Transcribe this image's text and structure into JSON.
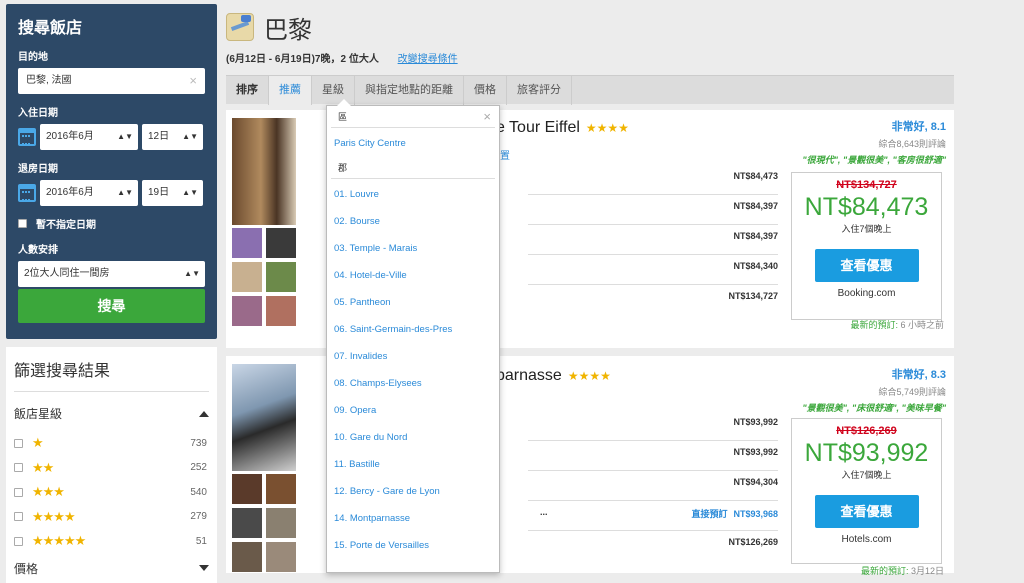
{
  "search": {
    "title": "搜尋飯店",
    "dest_label": "目的地",
    "dest_value": "巴黎, 法國",
    "clear_icon": "×",
    "checkin_label": "入住日期",
    "checkin_month": "2016年6月",
    "checkin_day": "12日",
    "checkout_label": "退房日期",
    "checkout_month": "2016年6月",
    "checkout_day": "19日",
    "nodate_label": "暫不指定日期",
    "guests_label": "人數安排",
    "guests_value": "2位大人同住一間房",
    "button": "搜尋"
  },
  "filter": {
    "title": "篩選搜尋結果",
    "star_header": "飯店星級",
    "stars": [
      {
        "stars": "★",
        "count": "739"
      },
      {
        "stars": "★★",
        "count": "252"
      },
      {
        "stars": "★★★",
        "count": "540"
      },
      {
        "stars": "★★★★",
        "count": "279"
      },
      {
        "stars": "★★★★★",
        "count": "51"
      }
    ],
    "price_header": "價格"
  },
  "header": {
    "city": "巴黎",
    "dates": "(6月12日 - 6月19日)7晚，2 位大人",
    "modify_link": "改變搜尋條件"
  },
  "sort": {
    "label": "排序",
    "tabs": [
      "推薦",
      "星級",
      "與指定地點的距離",
      "價格",
      "旅客評分"
    ]
  },
  "dropdown": {
    "area_header": "區",
    "area_item": "Paris City Centre",
    "district_header": "郡",
    "districts": [
      "01. Louvre",
      "02. Bourse",
      "03. Temple - Marais",
      "04. Hotel-de-Ville",
      "05. Pantheon",
      "06. Saint-Germain-des-Pres",
      "07. Invalides",
      "08. Champs-Elysees",
      "09. Opera",
      "10. Gare du Nord",
      "11. Bastille",
      "12. Bercy - Gare de Lyon",
      "14. Montparnasse",
      "15. Porte de Versailles"
    ]
  },
  "hotels": [
    {
      "name_tail": "e Tour Eiffel",
      "stars": "★★★★",
      "loc_tail": "置",
      "rating": "非常好, 8.1",
      "reviews": "綜合8,643則評論",
      "quotes": "\"很現代\", \"景觀很美\", \"客房很舒適\"",
      "prices": [
        "NT$84,473",
        "NT$84,397",
        "NT$84,397",
        "NT$84,340",
        "NT$134,727"
      ],
      "old_price": "NT$134,727",
      "price": "NT$84,473",
      "nights": "入住7個晚上",
      "view": "查看優惠",
      "site": "Booking.com",
      "recent": "最新的預訂:",
      "recent_time": "6 小時之前"
    },
    {
      "name_tail": "parnasse",
      "stars": "★★★★",
      "rating": "非常好, 8.3",
      "reviews": "綜合5,749則評論",
      "quotes": "\"景觀很美\", \"床很舒適\", \"美味早餐\"",
      "prices": [
        "NT$93,992",
        "NT$93,992",
        "NT$94,304",
        "NT$93,968",
        "NT$126,269"
      ],
      "direct": "直接預訂",
      "row4_prefix": "...",
      "old_price": "NT$126,269",
      "price": "NT$93,992",
      "nights": "入住7個晚上",
      "view": "查看優惠",
      "site": "Hotels.com",
      "recent": "最新的預訂:",
      "recent_time": "3月12日"
    }
  ]
}
